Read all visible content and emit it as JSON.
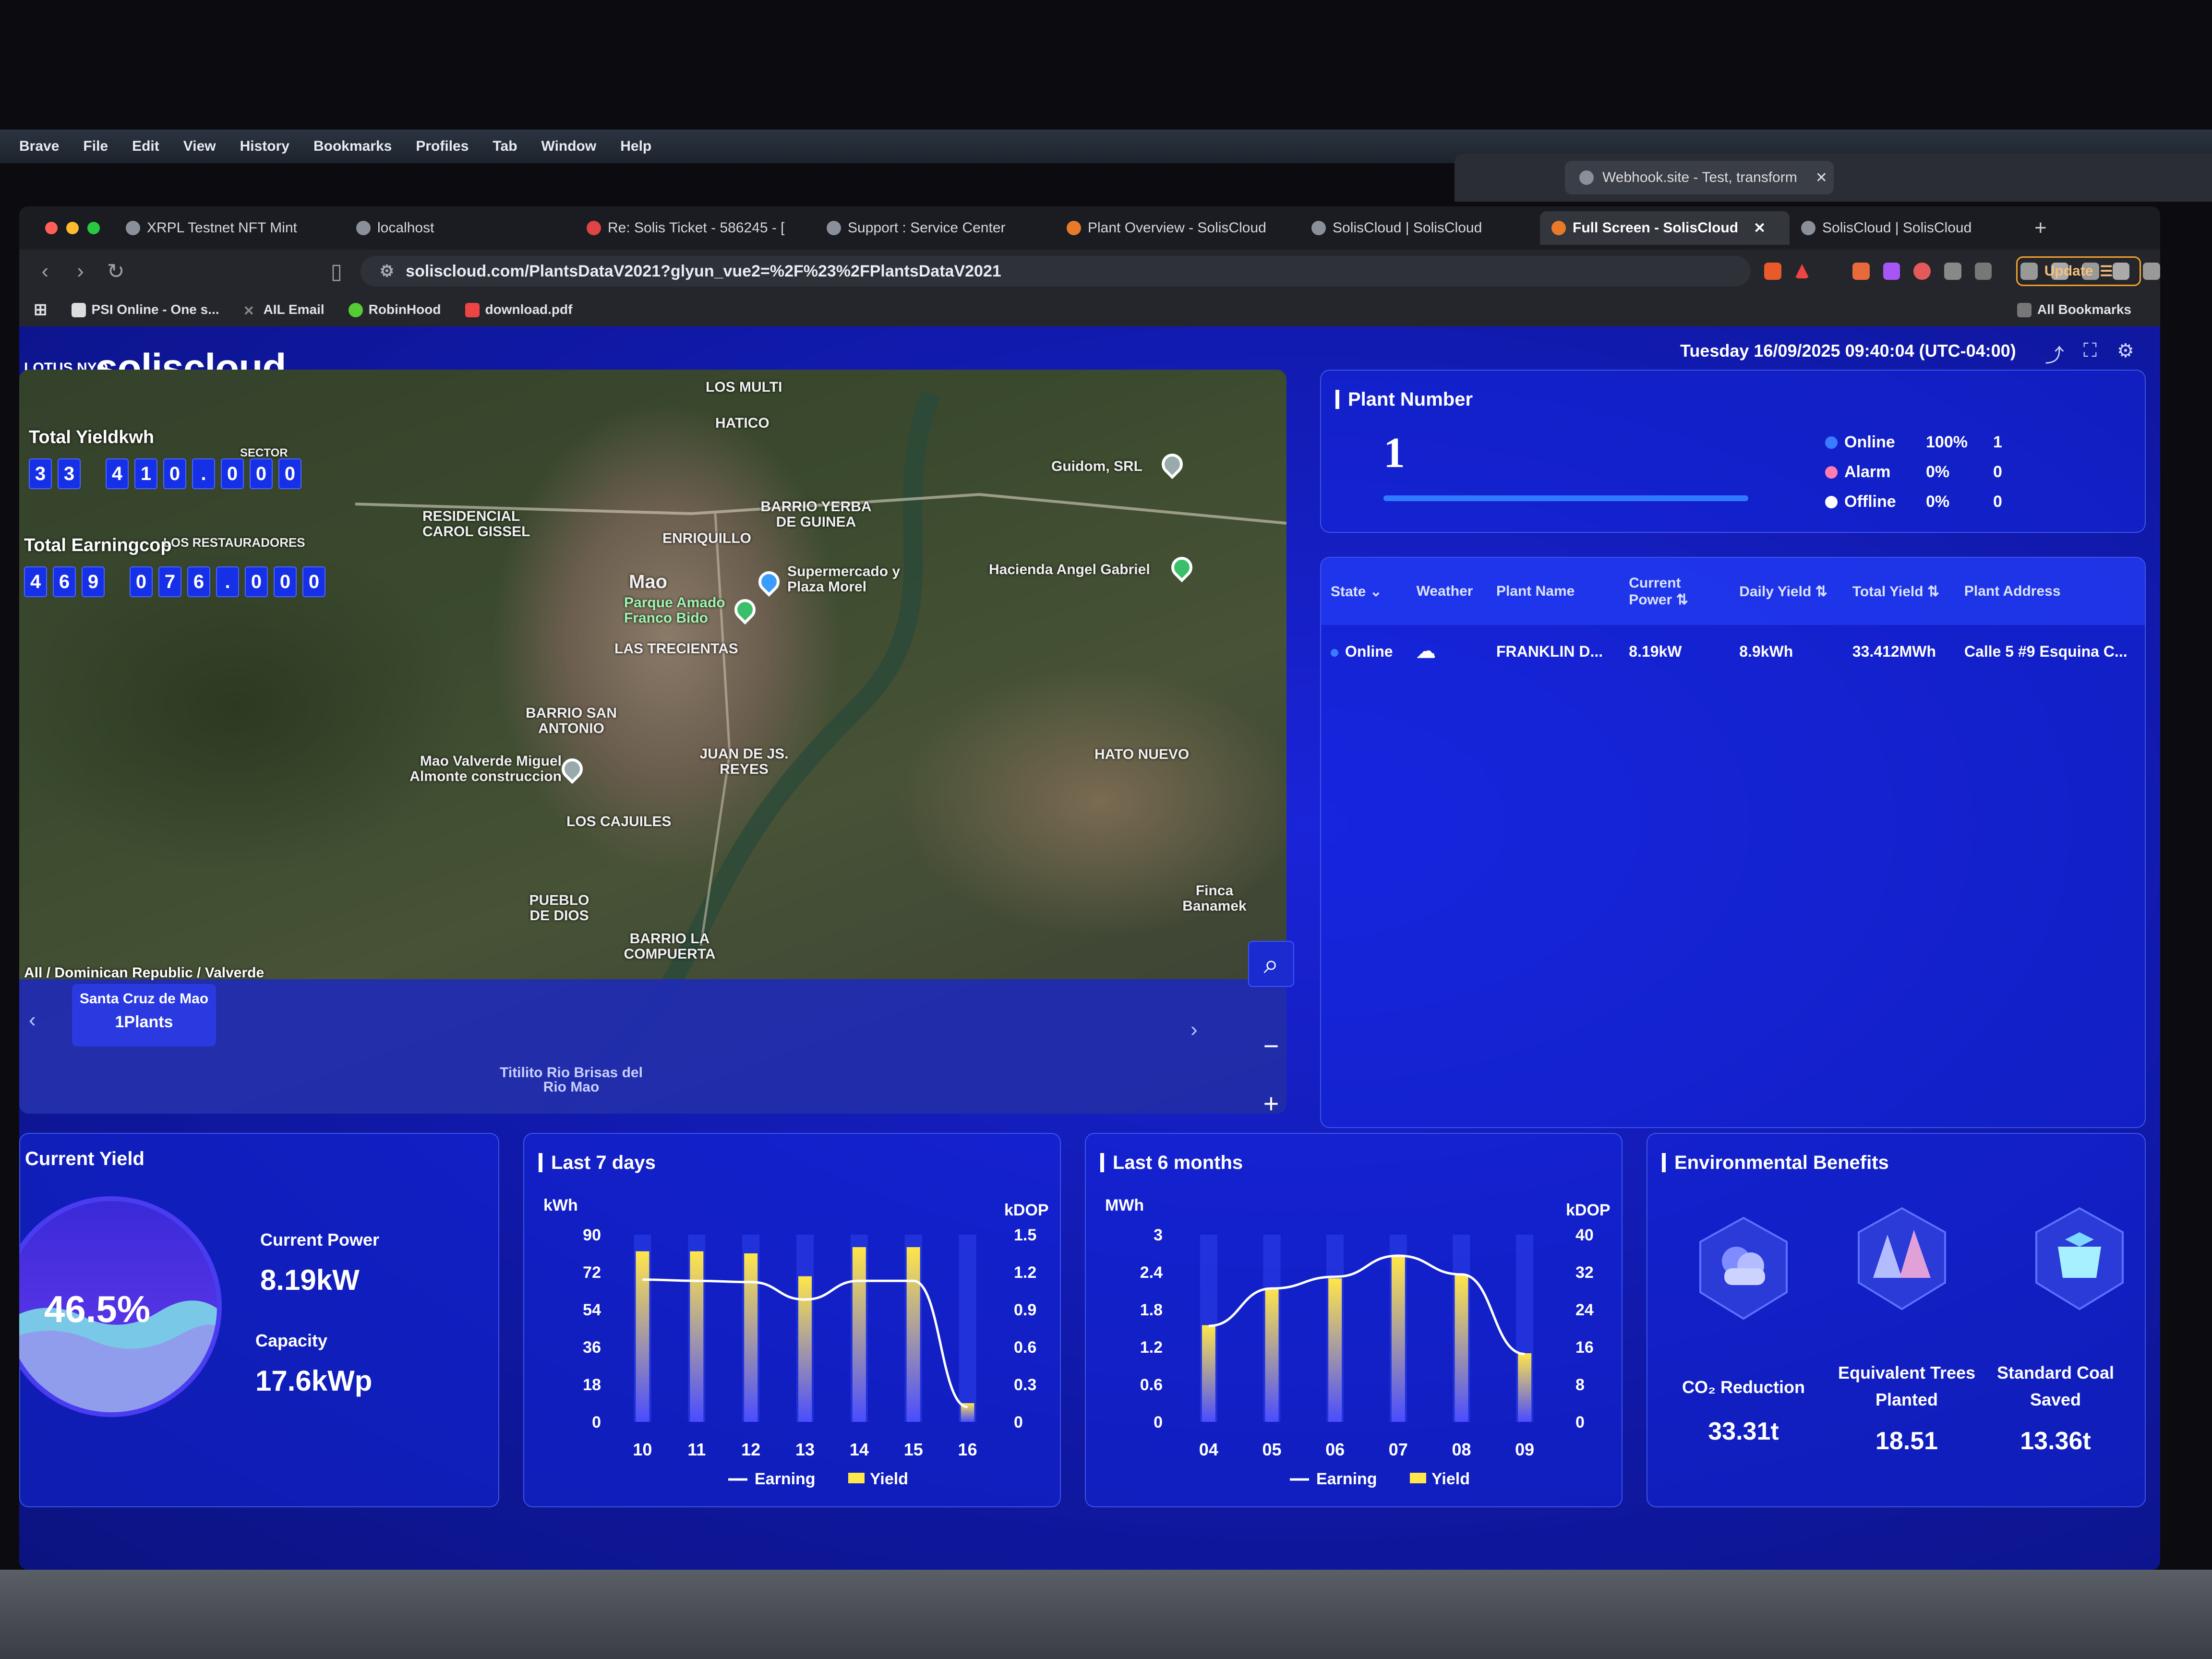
{
  "macos": {
    "menu": [
      "Brave",
      "File",
      "Edit",
      "View",
      "History",
      "Bookmarks",
      "Profiles",
      "Tab",
      "Window",
      "Help"
    ]
  },
  "bg_window": {
    "tab_title": "Webhook.site - Test, transform"
  },
  "browser": {
    "tabs": [
      {
        "title": "XRPL Testnet NFT Mint",
        "active": false
      },
      {
        "title": "localhost",
        "active": false
      },
      {
        "title": "Re: Solis Ticket - 586245 - [",
        "active": false
      },
      {
        "title": "Support : Service Center",
        "active": false
      },
      {
        "title": "Plant Overview - SolisCloud",
        "active": false
      },
      {
        "title": "SolisCloud | SolisCloud",
        "active": false
      },
      {
        "title": "Full Screen - SolisCloud",
        "active": true
      },
      {
        "title": "SolisCloud | SolisCloud",
        "active": false
      }
    ],
    "url": "soliscloud.com/PlantsDataV2021?glyun_vue2=%2F%23%2FPlantsDataV2021",
    "update_label": "Update",
    "bookmarks": [
      "PSI Online - One s...",
      "AIL Email",
      "RobinHood",
      "download.pdf"
    ],
    "all_bookmarks": "All Bookmarks"
  },
  "dashboard": {
    "brand_small": "LOTUS NYO",
    "brand": "soliscloud",
    "datetime": "Tuesday  16/09/2025 09:40:04 (UTC-04:00)",
    "map": {
      "total_yield_label": "Total Yieldkwh",
      "total_yield_digits": [
        "3",
        "3",
        "4",
        "1",
        "0",
        ".",
        "0",
        "0",
        "0"
      ],
      "total_earning_label": "Total Earningcop",
      "total_earning_digits": [
        "4",
        "6",
        "9",
        "0",
        "7",
        "6",
        ".",
        "0",
        "0",
        "0"
      ],
      "breadcrumb": "All / Dominican Republic / Valverde",
      "region_name": "Santa Cruz de Mao",
      "region_count": "1Plants",
      "places": [
        "LOS MULTI",
        "HATICO",
        "SECTOR",
        "RESIDENCIAL CAROL GISSEL",
        "LOS RESTAURADORES",
        "ENRIQUILLO",
        "BARRIO YERBA DE GUINEA",
        "Mao",
        "Supermercado y Plaza Morel",
        "Parque Amado Franco Bido",
        "LAS TRECIENTAS",
        "Guidom, SRL",
        "Hacienda Angel Gabriel",
        "HATO NUEVO",
        "BARRIO SAN ANTONIO",
        "Mao Valverde Miguel Almonte construccion",
        "JUAN DE JS. REYES",
        "LOS CAJUILES",
        "PUEBLO DE DIOS",
        "BARRIO LA COMPUERTA",
        "Finca Banamek",
        "Titilito Rio Brisas del Rio Mao"
      ]
    },
    "plant_number": {
      "title": "Plant Number",
      "count": "1",
      "statuses": [
        {
          "label": "Online",
          "pct": "100%",
          "count": "1",
          "color": "#3b7bff"
        },
        {
          "label": "Alarm",
          "pct": "0%",
          "count": "0",
          "color": "#ff7bb0"
        },
        {
          "label": "Offline",
          "pct": "0%",
          "count": "0",
          "color": "#ffffff"
        }
      ]
    },
    "plant_table": {
      "headers": [
        "State",
        "Weather",
        "Plant Name",
        "Current Power",
        "Daily Yield",
        "Total Yield",
        "Plant Address"
      ],
      "rows": [
        [
          "Online",
          "",
          "FRANKLIN D...",
          "8.19kW",
          "8.9kWh",
          "33.412MWh",
          "Calle 5 #9 Esquina C..."
        ]
      ]
    },
    "current_yield": {
      "title": "Current Yield",
      "percent": "46.5%",
      "power_label": "Current Power",
      "power_value": "8.19kW",
      "capacity_label": "Capacity",
      "capacity_value": "17.6kWp"
    },
    "last7": {
      "title": "Last 7 days"
    },
    "last6": {
      "title": "Last 6 months"
    },
    "env": {
      "title": "Environmental Benefits",
      "items": [
        {
          "label": "CO₂ Reduction",
          "value": "33.31t"
        },
        {
          "label": "Equivalent Trees Planted",
          "value": "18.51"
        },
        {
          "label": "Standard Coal Saved",
          "value": "13.36t"
        }
      ]
    }
  },
  "chart_data": [
    {
      "type": "bar",
      "title": "Last 7 days",
      "categories": [
        "10",
        "11",
        "12",
        "13",
        "14",
        "15",
        "16"
      ],
      "ylabel": "kWh",
      "y2label": "kDOP",
      "ylim": [
        0,
        90
      ],
      "y2lim": [
        0,
        1.5
      ],
      "yticks": [
        "0",
        "18",
        "36",
        "54",
        "72",
        "90"
      ],
      "y2ticks": [
        "0",
        "0.3",
        "0.6",
        "0.9",
        "1.2",
        "1.5"
      ],
      "series": [
        {
          "name": "Yield",
          "kind": "bar",
          "axis": "left",
          "values": [
            82,
            82,
            81,
            70,
            84,
            84,
            9
          ]
        },
        {
          "name": "Earning",
          "kind": "line",
          "axis": "right",
          "values": [
            1.14,
            1.13,
            1.12,
            0.98,
            1.13,
            1.13,
            0.12
          ]
        }
      ],
      "legend": [
        "Earning",
        "Yield"
      ]
    },
    {
      "type": "bar",
      "title": "Last 6 months",
      "categories": [
        "04",
        "05",
        "06",
        "07",
        "08",
        "09"
      ],
      "ylabel": "MWh",
      "y2label": "kDOP",
      "ylim": [
        0,
        3
      ],
      "y2lim": [
        0,
        40
      ],
      "yticks": [
        "0",
        "0.6",
        "1.2",
        "1.8",
        "2.4",
        "3"
      ],
      "y2ticks": [
        "0",
        "8",
        "16",
        "24",
        "32",
        "40"
      ],
      "series": [
        {
          "name": "Yield",
          "kind": "bar",
          "axis": "left",
          "values": [
            1.55,
            2.15,
            2.3,
            2.65,
            2.35,
            1.1
          ]
        },
        {
          "name": "Earning",
          "kind": "line",
          "axis": "right",
          "values": [
            20.5,
            28.5,
            31,
            35.5,
            31.5,
            14.5
          ]
        }
      ],
      "legend": [
        "Earning",
        "Yield"
      ]
    }
  ]
}
